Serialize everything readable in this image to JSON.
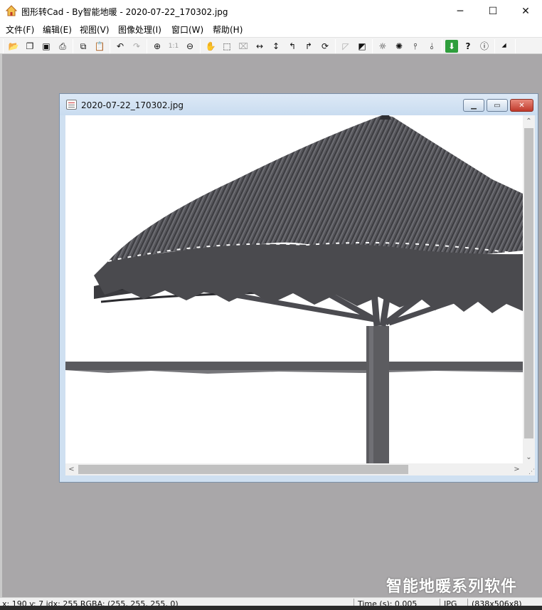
{
  "window": {
    "title": "图形转Cad - By智能地暖 - 2020-07-22_170302.jpg",
    "minimize_glyph": "─",
    "maximize_glyph": "☐",
    "close_glyph": "✕"
  },
  "menu": [
    {
      "label": "文件(F)"
    },
    {
      "label": "编辑(E)"
    },
    {
      "label": "视图(V)"
    },
    {
      "label": "图像处理(I)"
    },
    {
      "label": "窗口(W)"
    },
    {
      "label": "帮助(H)"
    }
  ],
  "toolbar": [
    {
      "icon": "open-folder-icon",
      "glyph": "📂"
    },
    {
      "icon": "new-window-icon",
      "glyph": "❐"
    },
    {
      "icon": "save-icon",
      "glyph": "▣"
    },
    {
      "icon": "print-icon",
      "glyph": "⎙"
    },
    {
      "icon": "copy-icon",
      "glyph": "⧉"
    },
    {
      "icon": "paste-icon",
      "glyph": "📋"
    },
    {
      "icon": "undo-icon",
      "glyph": "↶"
    },
    {
      "icon": "redo-icon",
      "glyph": "↷"
    },
    {
      "icon": "zoom-in-icon",
      "glyph": "⊕"
    },
    {
      "icon": "actual-size-icon",
      "glyph": "1:1"
    },
    {
      "icon": "zoom-out-icon",
      "glyph": "⊖"
    },
    {
      "icon": "hand-pan-icon",
      "glyph": "✋"
    },
    {
      "icon": "select-rect-icon",
      "glyph": "⬚"
    },
    {
      "icon": "crop-icon",
      "glyph": "⌧"
    },
    {
      "icon": "flip-horizontal-icon",
      "glyph": "↔"
    },
    {
      "icon": "flip-vertical-icon",
      "glyph": "↕"
    },
    {
      "icon": "rotate-left-icon",
      "glyph": "↰"
    },
    {
      "icon": "rotate-right-icon",
      "glyph": "↱"
    },
    {
      "icon": "rotate-free-icon",
      "glyph": "⟳"
    },
    {
      "icon": "gradient-light-icon",
      "glyph": "◸"
    },
    {
      "icon": "gradient-dark-icon",
      "glyph": "◩"
    },
    {
      "icon": "brightness-icon",
      "glyph": "☼"
    },
    {
      "icon": "contrast-icon",
      "glyph": "✺"
    },
    {
      "icon": "levels-icon",
      "glyph": "⫯"
    },
    {
      "icon": "threshold-icon",
      "glyph": "⫰"
    },
    {
      "icon": "download-icon",
      "glyph": "⬇"
    },
    {
      "icon": "help-icon",
      "glyph": "?"
    },
    {
      "icon": "info-icon",
      "glyph": "ⓘ"
    },
    {
      "icon": "tag-icon",
      "glyph": "⏷"
    }
  ],
  "document": {
    "title": "2020-07-22_170302.jpg",
    "minimize_glyph": "▁",
    "maximize_glyph": "▭",
    "close_glyph": "✕"
  },
  "scroll": {
    "up": "⌃",
    "down": "⌄",
    "left": "<",
    "right": ">",
    "grip": "⋰"
  },
  "watermark": "智能地暖系列软件",
  "status": {
    "pixel_info": "x: 190 y: 7  idx: 255  RGBA: (255, 255, 255, 0)",
    "time": "Time (s): 0.005",
    "format": "JPG",
    "size": "(838x506x8)"
  },
  "colors": {
    "workspace": "#a9a7a9",
    "thatch": "#4a4a4e",
    "pole": "#5c5c60"
  }
}
